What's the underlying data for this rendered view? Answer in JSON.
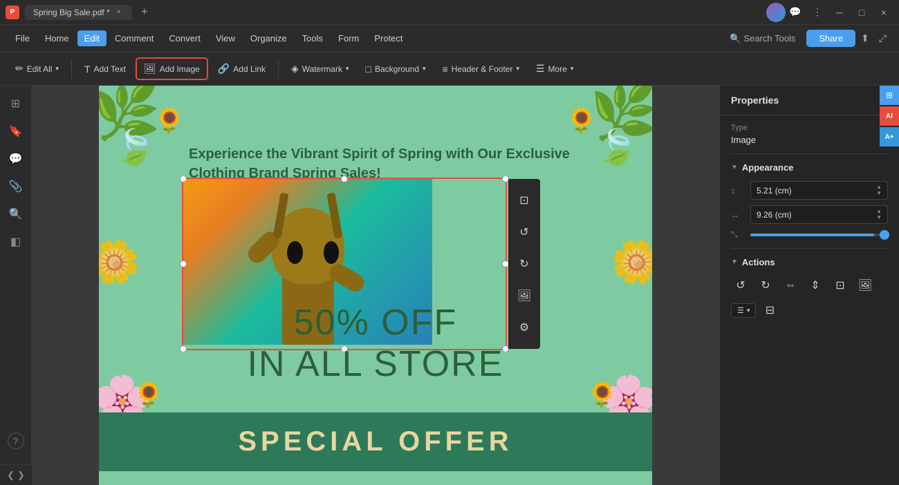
{
  "titlebar": {
    "app_icon": "P",
    "tab_name": "Spring Big Sale.pdf *",
    "close_tab": "×",
    "add_tab": "+",
    "avatar_alt": "user avatar"
  },
  "menubar": {
    "file": "File",
    "items": [
      "Home",
      "Edit",
      "Comment",
      "Convert",
      "View",
      "Organize",
      "Tools",
      "Form",
      "Protect"
    ],
    "active_item": "Edit",
    "search_tools": "Search Tools",
    "share": "Share"
  },
  "toolbar": {
    "edit_all": "Edit All",
    "add_text": "Add Text",
    "add_image": "Add Image",
    "add_link": "Add Link",
    "watermark": "Watermark",
    "background": "Background",
    "header_footer": "Header & Footer",
    "more": "More"
  },
  "properties_panel": {
    "title": "Properties",
    "type_label": "Type",
    "type_value": "Image",
    "appearance_label": "Appearance",
    "height_value": "5.21 (cm)",
    "width_value": "9.26 (cm)",
    "actions_label": "Actions"
  },
  "pdf_content": {
    "main_text": "Experience the Vibrant Spirit of Spring with Our Exclusive Clothing Brand Spring Sales!",
    "sale_line1": "50% OFF",
    "sale_line2": "IN ALL STORE",
    "special_offer": "SPECIAL OFFER"
  },
  "icons": {
    "thumbnails": "⊞",
    "bookmark": "🔖",
    "comment": "💬",
    "paperclip": "📎",
    "search": "🔍",
    "layers": "◫",
    "help": "?",
    "nav_left": "❮",
    "nav_right": "❯",
    "close": "×",
    "settings": "⚙",
    "chevron_down": "▼",
    "crop_icon": "⊡",
    "rotate_left": "↺",
    "rotate_right": "↻",
    "replace_icon": "⊞",
    "settings2": "⚙",
    "action_rotate_left": "↺",
    "action_rotate_right": "↻",
    "action_flip_h": "⇔",
    "action_flip_v": "⇕",
    "action_crop": "⊡",
    "action_replace": "⊞"
  }
}
